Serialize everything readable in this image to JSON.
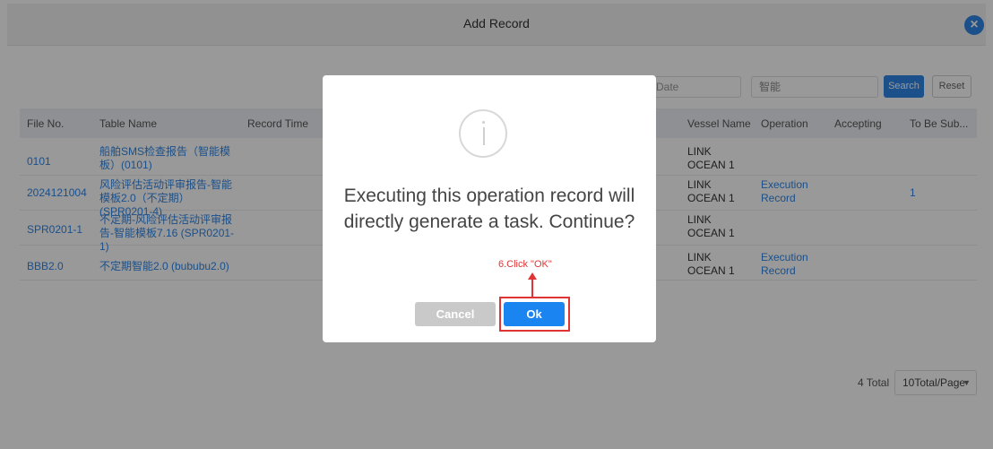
{
  "header": {
    "title": "Add Record",
    "close_icon": "close-icon"
  },
  "filters": {
    "date_placeholder": "Date",
    "keyword_value": "智能",
    "search_label": "Search",
    "reset_label": "Reset"
  },
  "table": {
    "columns": [
      "File No.",
      "Table Name",
      "Record Time",
      "Vessel Name",
      "Operation",
      "Accepting",
      "To Be Sub..."
    ],
    "rows": [
      {
        "file_no": "0101",
        "table_name": "船舶SMS检查报告（智能模板）(0101)",
        "vessel": "LINK OCEAN 1",
        "operation": "",
        "to_be_sub": ""
      },
      {
        "file_no": "2024121004",
        "table_name": "风险评估活动评审报告-智能模板2.0（不定期）(SPR0201-4)",
        "vessel": "LINK OCEAN 1",
        "operation": "Execution Record",
        "to_be_sub": "1"
      },
      {
        "file_no": "SPR0201-1",
        "table_name": "不定期-风险评估活动评审报告-智能模板7.16 (SPR0201-1)",
        "vessel": "LINK OCEAN 1",
        "operation": "",
        "to_be_sub": ""
      },
      {
        "file_no": "BBB2.0",
        "table_name": "不定期智能2.0 (bububu2.0)",
        "vessel": "LINK OCEAN 1",
        "operation": "Execution Record",
        "to_be_sub": ""
      }
    ]
  },
  "pagination": {
    "total": "4 Total",
    "page_size": "10Total/Page"
  },
  "modal": {
    "icon": "info-icon",
    "message": "Executing this operation record will directly generate a task. Continue?",
    "cancel_label": "Cancel",
    "ok_label": "Ok"
  },
  "annotation": {
    "text": "6.Click \"OK\"",
    "color": "#e03434"
  },
  "colors": {
    "accent": "#2f86e6"
  }
}
